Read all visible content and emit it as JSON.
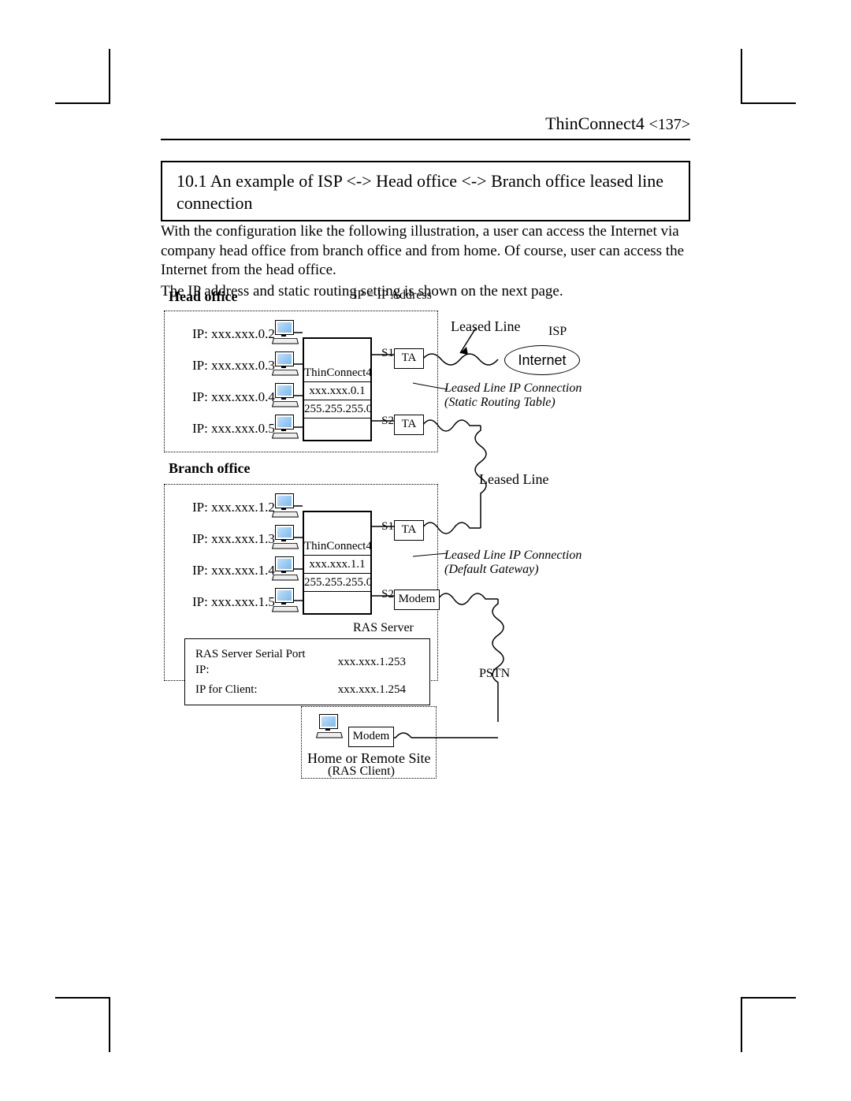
{
  "header": {
    "product": "ThinConnect4",
    "page": "<137>"
  },
  "title": "10.1 An example of ISP <-> Head office <-> Branch office leased line connection",
  "para1": "With the configuration like the following illustration, a user can access the Internet via company head office from branch office and from home. Of course, user can access the Internet from the head office.",
  "para2": "The IP address and static routing setting is shown on the next page.",
  "legend": "IP =  IP Address",
  "head_office": {
    "title": "Head office",
    "ips": [
      "IP: xxx.xxx.0.2",
      "IP: xxx.xxx.0.3",
      "IP: xxx.xxx.0.4",
      "IP: xxx.xxx.0.5"
    ],
    "router_name": "ThinConnect4",
    "router_ip": "xxx.xxx.0.1",
    "router_mask": "255.255.255.0",
    "s1": "S1",
    "s2": "S2",
    "ta1": "TA",
    "ta2": "TA",
    "leased_line": "Leased Line",
    "note1": "Leased Line IP Connection",
    "note2": "(Static Routing Table)"
  },
  "branch_office": {
    "title": "Branch office",
    "ips": [
      "IP: xxx.xxx.1.2",
      "IP: xxx.xxx.1.3",
      "IP: xxx.xxx.1.4",
      "IP: xxx.xxx.1.5"
    ],
    "router_name": "ThinConnect4",
    "router_ip": "xxx.xxx.1.1",
    "router_mask": "255.255.255.0",
    "s1": "S1",
    "s2": "S2",
    "ta": "TA",
    "modem": "Modem",
    "leased_line": "Leased Line",
    "note1": "Leased Line IP Connection",
    "note2": "(Default Gateway)",
    "ras_server": "RAS Server",
    "ras_ip_label": "RAS Server Serial Port IP:",
    "ras_ip": "xxx.xxx.1.253",
    "ras_client_label": "IP for Client:",
    "ras_client": "xxx.xxx.1.254"
  },
  "remote": {
    "modem": "Modem",
    "title": "Home or Remote Site",
    "sub": "(RAS Client)",
    "pstn": "PSTN"
  },
  "internet": "Internet",
  "isp": "ISP"
}
